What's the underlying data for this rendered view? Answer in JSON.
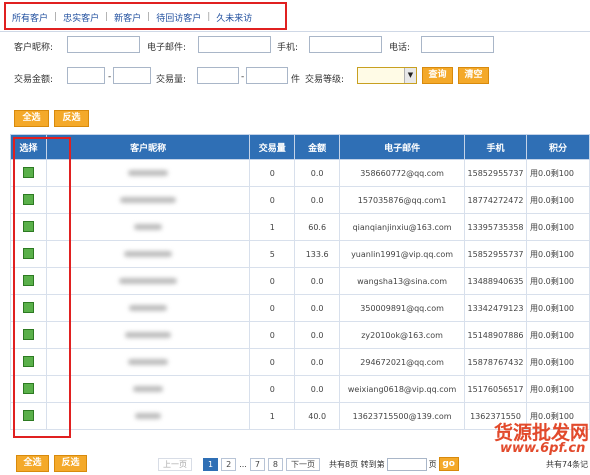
{
  "tabs": [
    "所有客户",
    "忠实客户",
    "新客户",
    "待回访客户",
    "久未来访"
  ],
  "filters": {
    "nickname_label": "客户昵称:",
    "email_label": "电子邮件:",
    "mobile_label": "手机:",
    "phone_label": "电话:",
    "amount_label": "交易金额:",
    "amount_sep": "-",
    "volume_label": "交易量:",
    "volume_sep": "-",
    "volume_unit": "件",
    "level_label": "交易等级:",
    "query_label": "查询",
    "clear_label": "清空"
  },
  "actions": {
    "select_all": "全选",
    "invert": "反选"
  },
  "table": {
    "headers": [
      "选择",
      "客户昵称",
      "交易量",
      "金额",
      "电子邮件",
      "手机",
      "积分"
    ],
    "rows": [
      {
        "volume": "0",
        "amount": "0.0",
        "email": "358660772@qq.com",
        "mobile": "15852955737",
        "points": "用0.0剩100"
      },
      {
        "volume": "0",
        "amount": "0.0",
        "email": "157035876@qq.com1",
        "mobile": "18774272472",
        "points": "用0.0剩100"
      },
      {
        "volume": "1",
        "amount": "60.6",
        "email": "qianqianjinxiu@163.com",
        "mobile": "13395735358",
        "points": "用0.0剩100"
      },
      {
        "volume": "5",
        "amount": "133.6",
        "email": "yuanlin1991@vip.qq.com",
        "mobile": "15852955737",
        "points": "用0.0剩100"
      },
      {
        "volume": "0",
        "amount": "0.0",
        "email": "wangsha13@sina.com",
        "mobile": "13488940635",
        "points": "用0.0剩100"
      },
      {
        "volume": "0",
        "amount": "0.0",
        "email": "350009891@qq.com",
        "mobile": "13342479123",
        "points": "用0.0剩100"
      },
      {
        "volume": "0",
        "amount": "0.0",
        "email": "zy2010ok@163.com",
        "mobile": "15148907886",
        "points": "用0.0剩100"
      },
      {
        "volume": "0",
        "amount": "0.0",
        "email": "294672021@qq.com",
        "mobile": "15878767432",
        "points": "用0.0剩100"
      },
      {
        "volume": "0",
        "amount": "0.0",
        "email": "weixiang0618@vip.qq.com",
        "mobile": "15176056517",
        "points": "用0.0剩100"
      },
      {
        "volume": "1",
        "amount": "40.0",
        "email": "13623715500@139.com",
        "mobile": "1362371550",
        "points": "用0.0剩100"
      }
    ]
  },
  "pager": {
    "prev": "上一页",
    "pages": [
      "1",
      "2",
      "...",
      "7",
      "8"
    ],
    "next": "下一页",
    "total_prefix": "共有8页 转到第",
    "page_suffix": "页",
    "go": "go",
    "total_records": "共有74条记"
  },
  "watermark": {
    "text": "货源批发网",
    "url": "www.6pf.cn"
  },
  "colors": {
    "header_bg": "#2f6fb5",
    "button": "#f4a92a",
    "checkbox": "#5ab04a",
    "highlight_box": "#e02020"
  }
}
